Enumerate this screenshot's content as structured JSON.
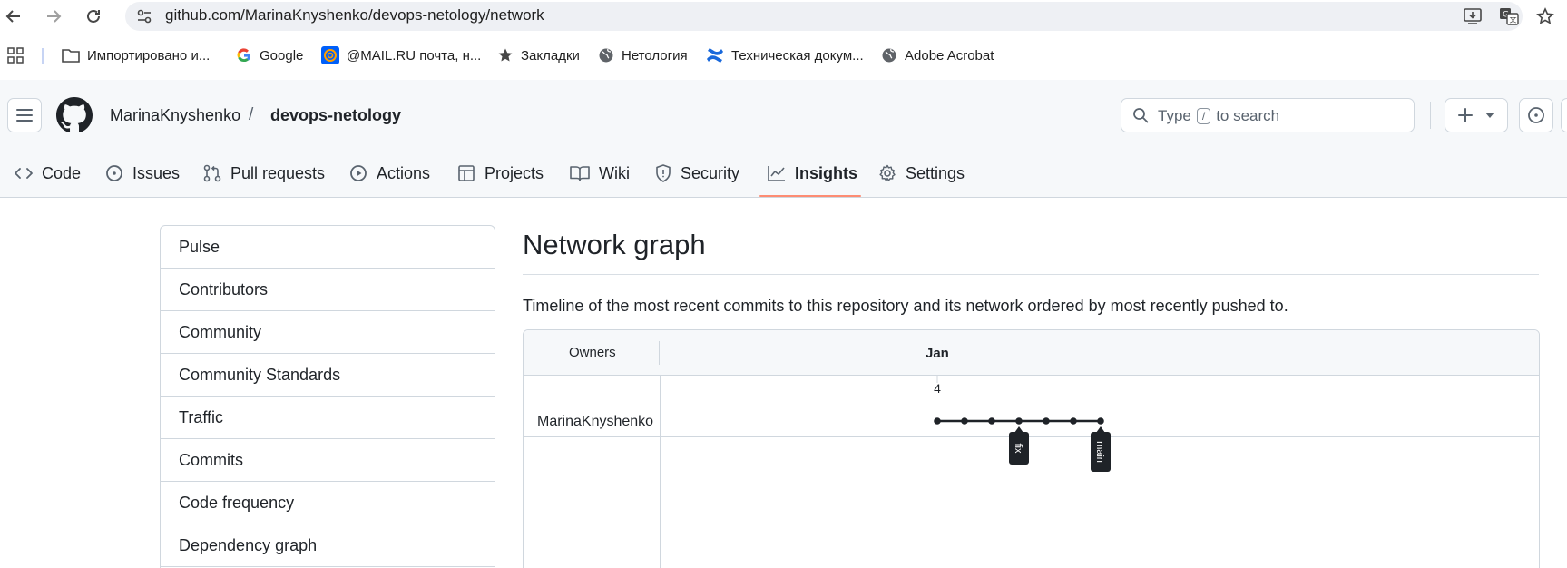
{
  "browser": {
    "url": "github.com/MarinaKnyshenko/devops-netology/network",
    "bookmarks": [
      {
        "label": "Импортировано и...",
        "icon": "folder-icon"
      },
      {
        "label": "Google",
        "icon": "google-icon"
      },
      {
        "label": "@MAIL.RU почта, н...",
        "icon": "mailru-icon"
      },
      {
        "label": "Закладки",
        "icon": "star-icon"
      },
      {
        "label": "Нетология",
        "icon": "globe-icon"
      },
      {
        "label": "Техническая докум...",
        "icon": "confluence-icon"
      },
      {
        "label": "Adobe Acrobat",
        "icon": "globe-icon"
      }
    ]
  },
  "header": {
    "owner": "MarinaKnyshenko",
    "separator": "/",
    "repo": "devops-netology",
    "search_prefix": "Type",
    "search_key": "/",
    "search_suffix": "to search"
  },
  "tabs": [
    {
      "label": "Code",
      "icon": "code-icon"
    },
    {
      "label": "Issues",
      "icon": "issue-icon"
    },
    {
      "label": "Pull requests",
      "icon": "pull-request-icon"
    },
    {
      "label": "Actions",
      "icon": "play-icon"
    },
    {
      "label": "Projects",
      "icon": "table-icon"
    },
    {
      "label": "Wiki",
      "icon": "book-icon"
    },
    {
      "label": "Security",
      "icon": "shield-icon"
    },
    {
      "label": "Insights",
      "icon": "graph-icon",
      "active": true
    },
    {
      "label": "Settings",
      "icon": "gear-icon"
    }
  ],
  "sidebar": {
    "items": [
      "Pulse",
      "Contributors",
      "Community",
      "Community Standards",
      "Traffic",
      "Commits",
      "Code frequency",
      "Dependency graph"
    ]
  },
  "main": {
    "title": "Network graph",
    "description": "Timeline of the most recent commits to this repository and its network ordered by most recently pushed to.",
    "owners_header": "Owners",
    "month": "Jan",
    "day": "4",
    "owner_row": "MarinaKnyshenko",
    "commit_count": 7,
    "branch_labels": [
      {
        "name": "fix",
        "commit_index": 3
      },
      {
        "name": "main",
        "commit_index": 6
      }
    ]
  },
  "colors": {
    "active_tab_underline": "#fd8c73",
    "border": "#d0d7de",
    "graph_line": "#1f2328"
  }
}
